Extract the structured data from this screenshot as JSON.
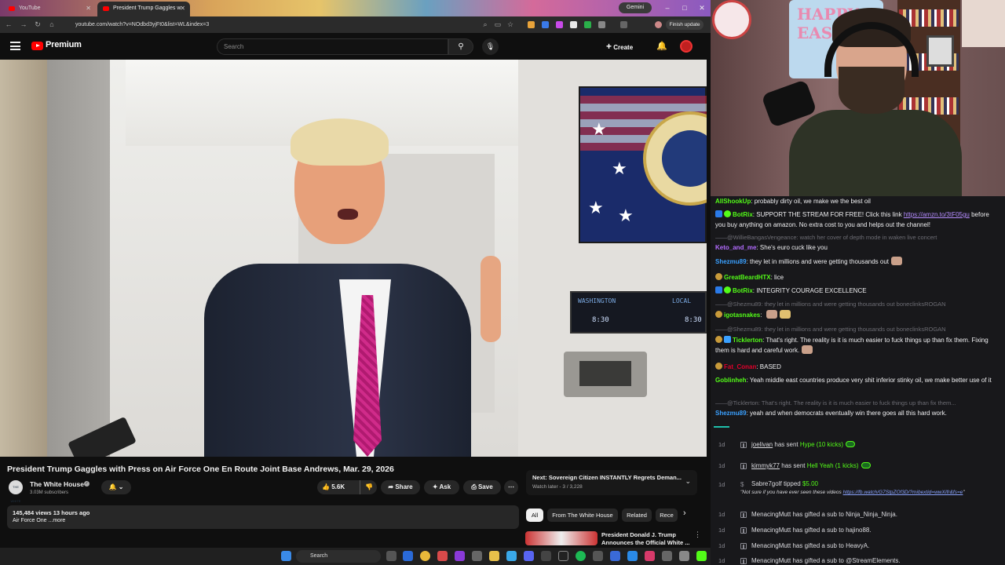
{
  "browser": {
    "tabs": [
      {
        "label": "YouTube",
        "active": false
      },
      {
        "label": "President Trump Gaggles w",
        "active": true
      }
    ],
    "url": "youtube.com/watch?v=NOdbd3yjFt0&list=WL&index=3",
    "gemini_label": "Gemini",
    "finish_update_label": "Finish update"
  },
  "youtube": {
    "brand": "Premium",
    "search_placeholder": "Search",
    "create_label": "Create",
    "video": {
      "title": "President Trump Gaggles with Press on Air Force One En Route Joint Base Andrews, Mar. 29, 2026",
      "channel_name": "The White House",
      "channel_icon_text": "THE WHITE HOUSE",
      "subscribers": "3.03M subscribers",
      "likes": "5.6K",
      "share_label": "Share",
      "ask_label": "Ask",
      "save_label": "Save",
      "more_label": "⋯",
      "views_and_age": "145,484 views  13 hours ago",
      "description_preview": "Air Force One ...more",
      "scene_text": {
        "left_label": "WASHINGTON",
        "right_label": "LOCAL",
        "time_left": "8:30",
        "time_right": "8:30"
      }
    },
    "next": {
      "label": "Next: Sovereign Citizen INSTANTLY Regrets Deman...",
      "sub": "Watch later - 3 / 3,228"
    },
    "chips": [
      "All",
      "From The White House",
      "Related",
      "Rece"
    ],
    "related": {
      "title": "President Donald J. Trump Announces the Official White ..."
    }
  },
  "taskbar": {
    "search_label": "Search"
  },
  "webcam": {
    "banner_text": "HAPPY EASTE"
  },
  "chat": {
    "messages": [
      {
        "user": "AllShookUp",
        "color": "#53fc18",
        "text": "probably dirty oil, we make we the best oil"
      },
      {
        "user": "BotRix",
        "color": "#53fc18",
        "text": "SUPPORT THE STREAM FOR FREE! Click this link ",
        "link": "https://amzn.to/3tF05gu",
        "text2": " before you buy anything on amazon. No extra cost to you and helps out the channel!"
      },
      {
        "reply": "——@WillieBangasVengeance: watch her cover of depth mode in waken live concert"
      },
      {
        "user": "Keto_and_me",
        "color": "#b36cff",
        "text": "She's euro cuck like you"
      },
      {
        "user": "Shezmu89",
        "color": "#3aa0ff",
        "text": "they let in millions and were getting thousands out"
      },
      {
        "user": "GreatBeardHTX",
        "color": "#53fc18",
        "text": "lice"
      },
      {
        "user": "BotRix",
        "color": "#53fc18",
        "text": "INTEGRITY COURAGE EXCELLENCE"
      },
      {
        "reply": "——@Shezmu89: they let in millions and were getting thousands out boneclinksROGAN"
      },
      {
        "user": "igotasnakes",
        "color": "#53fc18",
        "text": ""
      },
      {
        "reply": "——@Shezmu89: they let in millions and were getting thousands out boneclinksROGAN"
      },
      {
        "user": "Ticklerton",
        "color": "#53fc18",
        "text": "That's right. The reality is it is much easier to fuck things up than fix them. Fixing them is hard and careful work."
      },
      {
        "user": "Fat_Conan",
        "color": "#e0002b",
        "text": "BASED"
      },
      {
        "user": "Goblinheh",
        "color": "#53fc18",
        "text": "Yeah middle east countries produce very shit inferior stinky oil, we make better use of it"
      },
      {
        "reply": "——@Ticklerton: That's right. The reality is it is much easier to fuck things up than fix them..."
      },
      {
        "user": "Shezmu89",
        "color": "#3aa0ff",
        "text": "yeah and when democrats eventually win there goes all this hard work."
      }
    ]
  },
  "alerts": {
    "age": "1d",
    "items": [
      {
        "user": "joelivan",
        "action": "has sent",
        "gift": "Hype (10 kicks)"
      },
      {
        "user": "kimmyk77",
        "action": "has sent",
        "gift": "Hell Yeah (1 kicks)"
      },
      {
        "tip_user": "Sabre7golf",
        "tip_action": "tipped",
        "tip_amount": "$5.00",
        "tip_message": "\"Not sure if you have ever seen these videos ",
        "tip_link": "https://fb.watch/G7StpZOf3D/?mibextid=wwXIfr&fs=e",
        "tip_end": "\""
      },
      {
        "user": "MenacingMutt",
        "action": "has gifted a sub to",
        "target": "Ninja_Ninja_Ninja."
      },
      {
        "user": "MenacingMutt",
        "action": "has gifted a sub to",
        "target": "hajino88."
      },
      {
        "user": "MenacingMutt",
        "action": "has gifted a sub to",
        "target": "HeavyA."
      },
      {
        "user": "MenacingMutt",
        "action": "has gifted a sub to",
        "target": "@StreamElements."
      }
    ]
  }
}
